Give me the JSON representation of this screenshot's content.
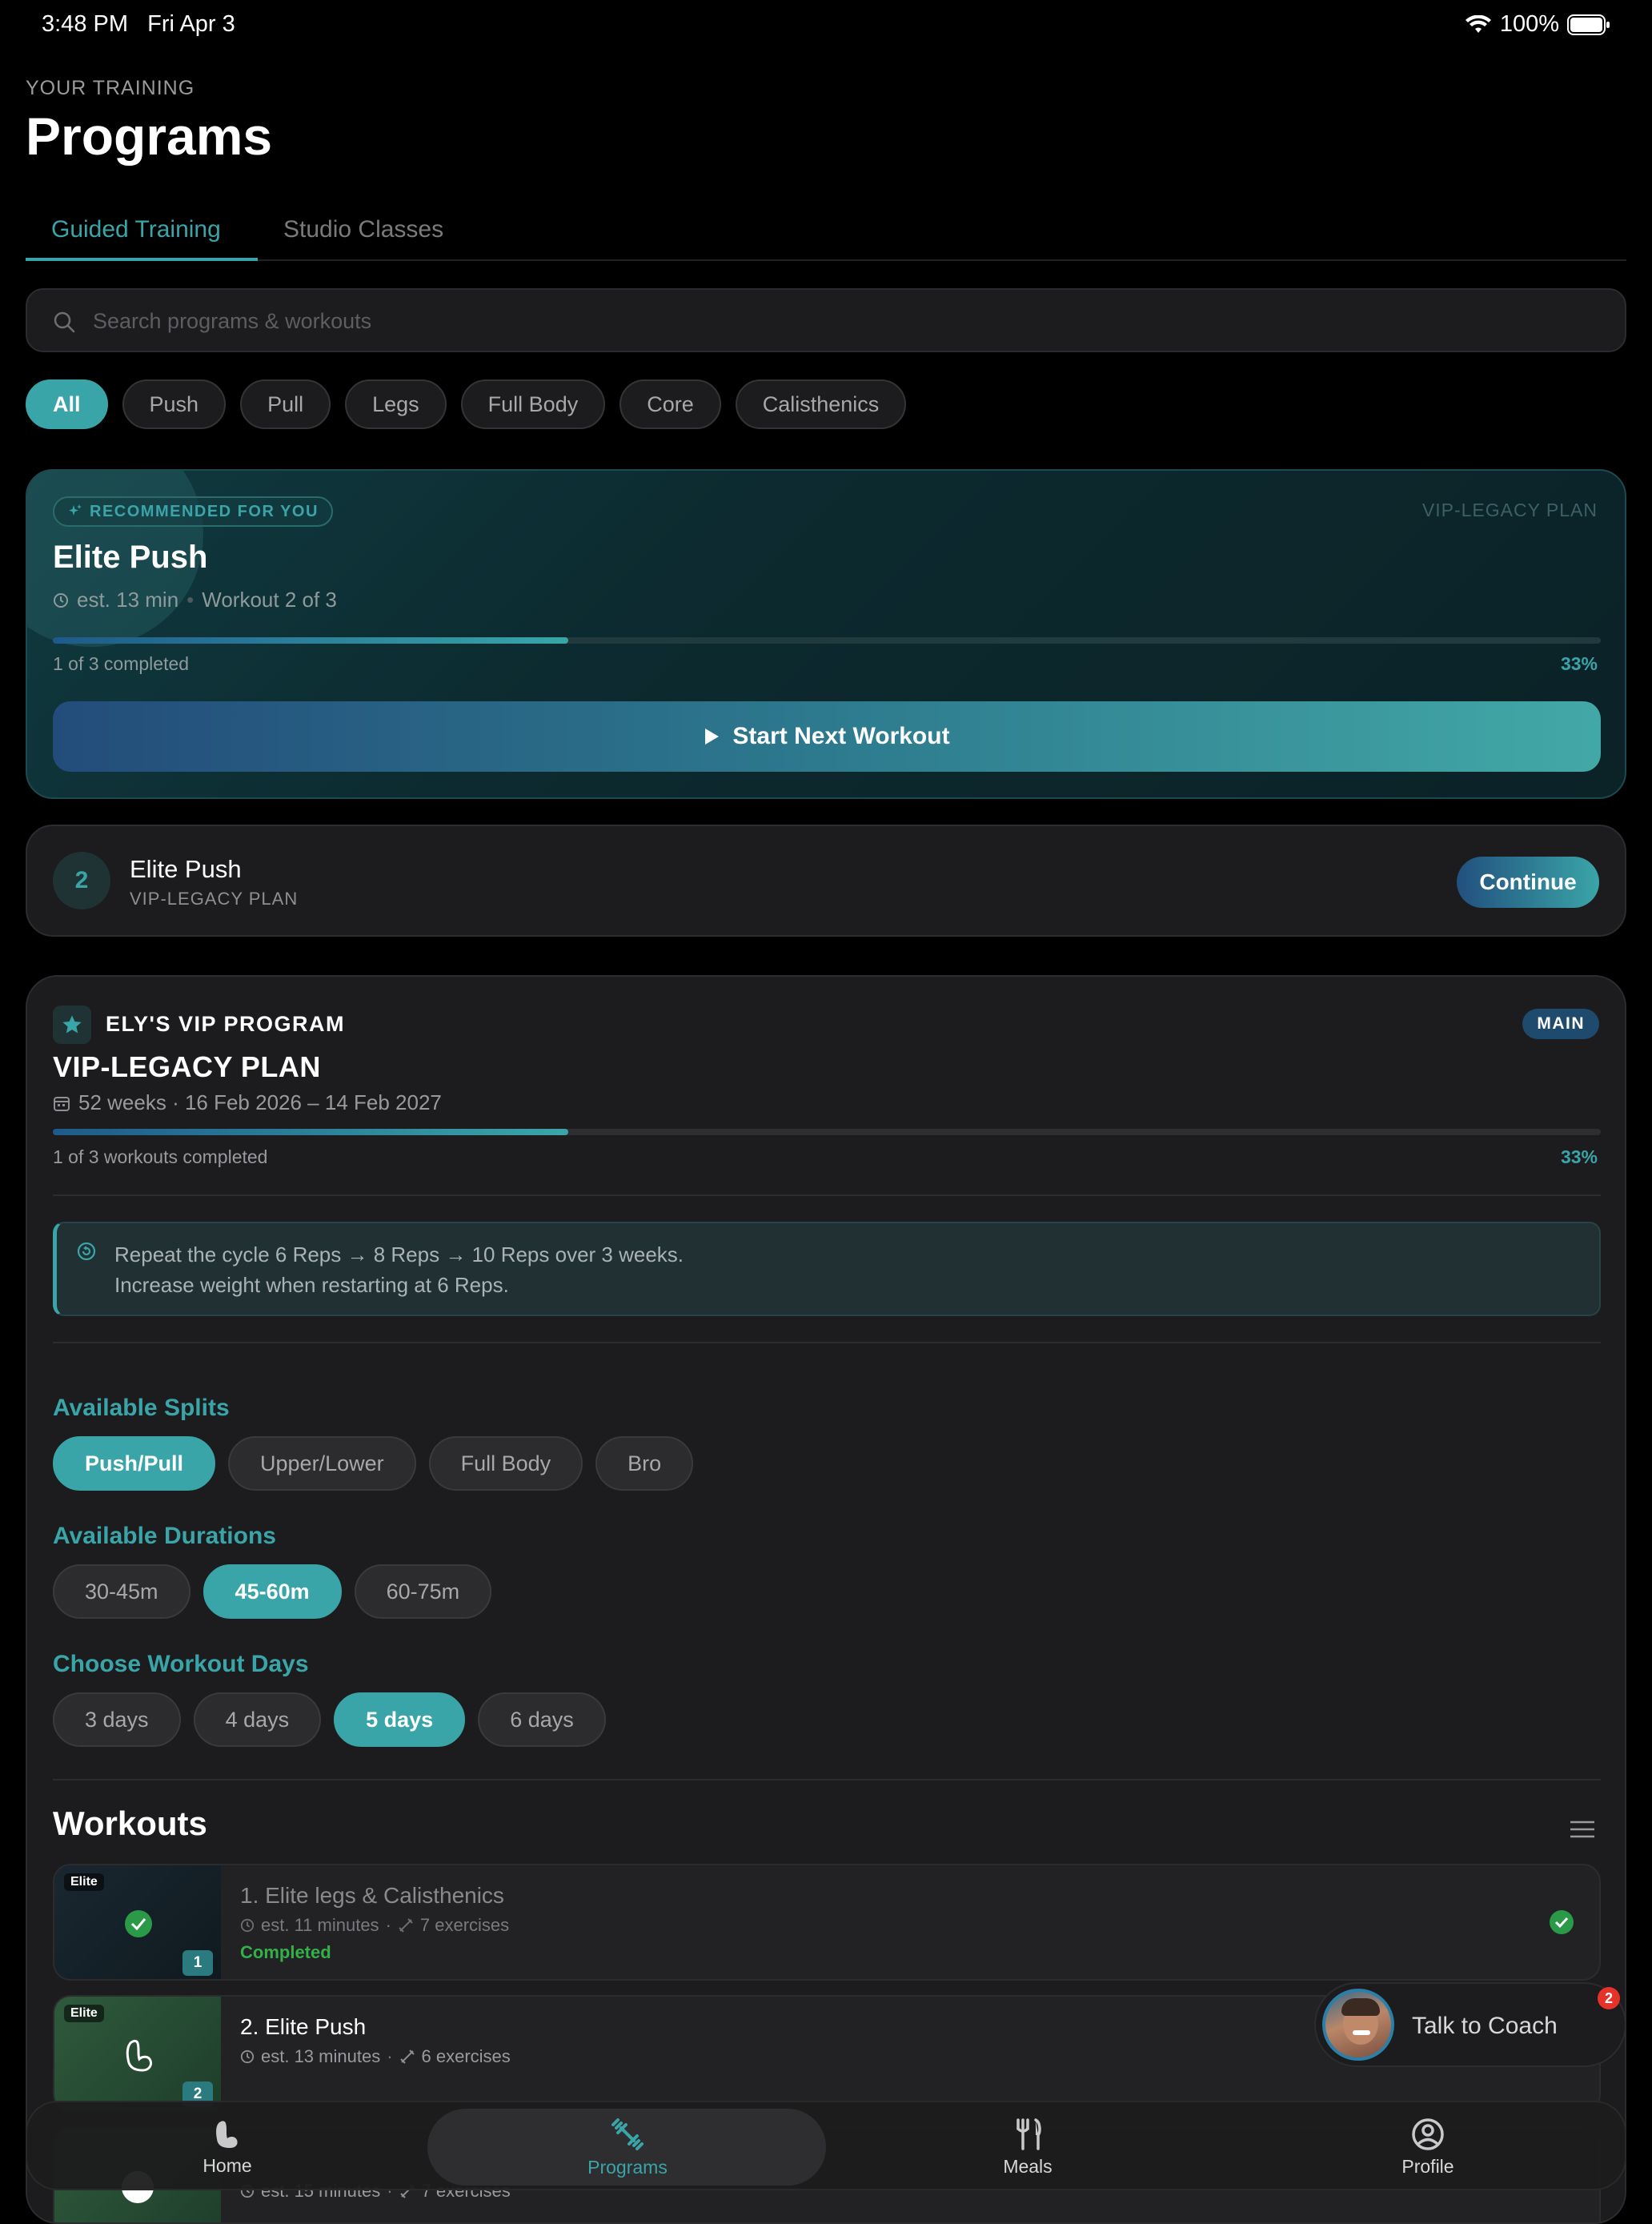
{
  "status": {
    "time": "3:48 PM",
    "date": "Fri Apr 3",
    "battery": "100%"
  },
  "header": {
    "eyebrow": "YOUR TRAINING",
    "title": "Programs"
  },
  "tabs": [
    {
      "label": "Guided Training",
      "active": true
    },
    {
      "label": "Studio Classes",
      "active": false
    }
  ],
  "search": {
    "placeholder": "Search programs & workouts"
  },
  "filters": [
    "All",
    "Push",
    "Pull",
    "Legs",
    "Full Body",
    "Core",
    "Calisthenics"
  ],
  "recommended": {
    "badge": "RECOMMENDED FOR YOU",
    "plan": "VIP-LEGACY PLAN",
    "title": "Elite Push",
    "duration": "est. 13 min",
    "workout": "Workout 2 of 3",
    "progress_label": "1 of 3 completed",
    "progress_pct": "33%",
    "progress_value": 0.333,
    "button": "Start Next Workout"
  },
  "continue_card": {
    "number": "2",
    "title": "Elite Push",
    "subtitle": "VIP-LEGACY PLAN",
    "button": "Continue"
  },
  "program": {
    "name": "ELY'S VIP PROGRAM",
    "badge": "MAIN",
    "plan_title": "VIP-LEGACY PLAN",
    "meta": "52 weeks · 16 Feb 2026 – 14 Feb 2027",
    "progress_label": "1 of 3 workouts completed",
    "progress_pct": "33%",
    "progress_value": 0.333,
    "note_line1": "Repeat the cycle 6 Reps → 8 Reps → 10 Reps over 3 weeks.",
    "note_line2": "Increase weight when restarting at 6 Reps.",
    "splits_label": "Available Splits",
    "splits": [
      "Push/Pull",
      "Upper/Lower",
      "Full Body",
      "Bro"
    ],
    "splits_selected": 0,
    "durations_label": "Available Durations",
    "durations": [
      "30-45m",
      "45-60m",
      "60-75m"
    ],
    "durations_selected": 1,
    "days_label": "Choose Workout Days",
    "days": [
      "3 days",
      "4 days",
      "5 days",
      "6 days"
    ],
    "days_selected": 2,
    "workouts_label": "Workouts",
    "workouts": [
      {
        "tag": "Elite",
        "num": "1",
        "title": "1. Elite legs & Calisthenics",
        "duration": "est. 11 minutes",
        "exercises": "7 exercises",
        "status": "Completed"
      },
      {
        "tag": "Elite",
        "num": "2",
        "title": "2. Elite Push",
        "duration": "est. 13 minutes",
        "exercises": "6 exercises",
        "status": ""
      },
      {
        "tag": "",
        "num": "",
        "title": "",
        "duration": "est. 15 minutes",
        "exercises": "7 exercises",
        "status": ""
      }
    ]
  },
  "coach": {
    "label": "Talk to Coach",
    "badge": "2"
  },
  "tabbar": [
    {
      "label": "Home",
      "icon": "flexed-arm-icon",
      "active": false
    },
    {
      "label": "Programs",
      "icon": "dumbbell-icon",
      "active": true
    },
    {
      "label": "Meals",
      "icon": "fork-knife-icon",
      "active": false
    },
    {
      "label": "Profile",
      "icon": "user-circle-icon",
      "active": false
    }
  ],
  "colors": {
    "accent": "#3aa5a8",
    "success": "#33b04a",
    "notification": "#e5332a",
    "background": "#000000",
    "card": "#1c1c1e"
  }
}
